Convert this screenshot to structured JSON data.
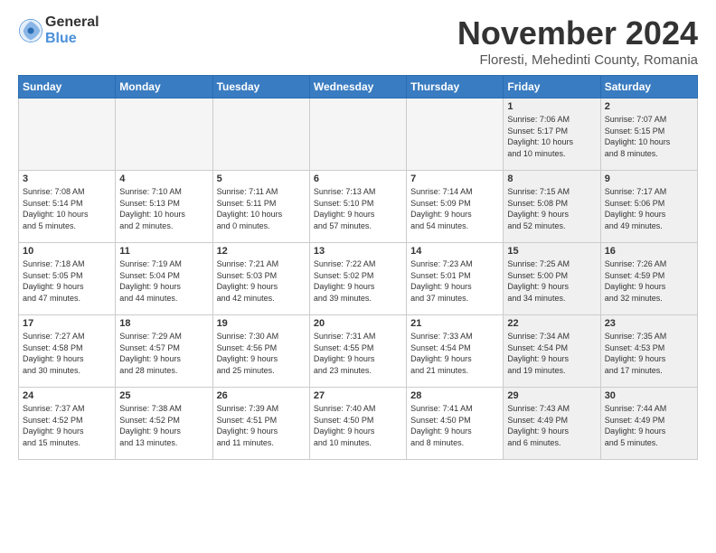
{
  "header": {
    "logo_line1": "General",
    "logo_line2": "Blue",
    "month": "November 2024",
    "location": "Floresti, Mehedinti County, Romania"
  },
  "weekdays": [
    "Sunday",
    "Monday",
    "Tuesday",
    "Wednesday",
    "Thursday",
    "Friday",
    "Saturday"
  ],
  "weeks": [
    [
      {
        "day": "",
        "info": "",
        "empty": true
      },
      {
        "day": "",
        "info": "",
        "empty": true
      },
      {
        "day": "",
        "info": "",
        "empty": true
      },
      {
        "day": "",
        "info": "",
        "empty": true
      },
      {
        "day": "",
        "info": "",
        "empty": true
      },
      {
        "day": "1",
        "info": "Sunrise: 7:06 AM\nSunset: 5:17 PM\nDaylight: 10 hours\nand 10 minutes.",
        "shaded": true
      },
      {
        "day": "2",
        "info": "Sunrise: 7:07 AM\nSunset: 5:15 PM\nDaylight: 10 hours\nand 8 minutes.",
        "shaded": true
      }
    ],
    [
      {
        "day": "3",
        "info": "Sunrise: 7:08 AM\nSunset: 5:14 PM\nDaylight: 10 hours\nand 5 minutes."
      },
      {
        "day": "4",
        "info": "Sunrise: 7:10 AM\nSunset: 5:13 PM\nDaylight: 10 hours\nand 2 minutes."
      },
      {
        "day": "5",
        "info": "Sunrise: 7:11 AM\nSunset: 5:11 PM\nDaylight: 10 hours\nand 0 minutes."
      },
      {
        "day": "6",
        "info": "Sunrise: 7:13 AM\nSunset: 5:10 PM\nDaylight: 9 hours\nand 57 minutes."
      },
      {
        "day": "7",
        "info": "Sunrise: 7:14 AM\nSunset: 5:09 PM\nDaylight: 9 hours\nand 54 minutes."
      },
      {
        "day": "8",
        "info": "Sunrise: 7:15 AM\nSunset: 5:08 PM\nDaylight: 9 hours\nand 52 minutes.",
        "shaded": true
      },
      {
        "day": "9",
        "info": "Sunrise: 7:17 AM\nSunset: 5:06 PM\nDaylight: 9 hours\nand 49 minutes.",
        "shaded": true
      }
    ],
    [
      {
        "day": "10",
        "info": "Sunrise: 7:18 AM\nSunset: 5:05 PM\nDaylight: 9 hours\nand 47 minutes."
      },
      {
        "day": "11",
        "info": "Sunrise: 7:19 AM\nSunset: 5:04 PM\nDaylight: 9 hours\nand 44 minutes."
      },
      {
        "day": "12",
        "info": "Sunrise: 7:21 AM\nSunset: 5:03 PM\nDaylight: 9 hours\nand 42 minutes."
      },
      {
        "day": "13",
        "info": "Sunrise: 7:22 AM\nSunset: 5:02 PM\nDaylight: 9 hours\nand 39 minutes."
      },
      {
        "day": "14",
        "info": "Sunrise: 7:23 AM\nSunset: 5:01 PM\nDaylight: 9 hours\nand 37 minutes."
      },
      {
        "day": "15",
        "info": "Sunrise: 7:25 AM\nSunset: 5:00 PM\nDaylight: 9 hours\nand 34 minutes.",
        "shaded": true
      },
      {
        "day": "16",
        "info": "Sunrise: 7:26 AM\nSunset: 4:59 PM\nDaylight: 9 hours\nand 32 minutes.",
        "shaded": true
      }
    ],
    [
      {
        "day": "17",
        "info": "Sunrise: 7:27 AM\nSunset: 4:58 PM\nDaylight: 9 hours\nand 30 minutes."
      },
      {
        "day": "18",
        "info": "Sunrise: 7:29 AM\nSunset: 4:57 PM\nDaylight: 9 hours\nand 28 minutes."
      },
      {
        "day": "19",
        "info": "Sunrise: 7:30 AM\nSunset: 4:56 PM\nDaylight: 9 hours\nand 25 minutes."
      },
      {
        "day": "20",
        "info": "Sunrise: 7:31 AM\nSunset: 4:55 PM\nDaylight: 9 hours\nand 23 minutes."
      },
      {
        "day": "21",
        "info": "Sunrise: 7:33 AM\nSunset: 4:54 PM\nDaylight: 9 hours\nand 21 minutes."
      },
      {
        "day": "22",
        "info": "Sunrise: 7:34 AM\nSunset: 4:54 PM\nDaylight: 9 hours\nand 19 minutes.",
        "shaded": true
      },
      {
        "day": "23",
        "info": "Sunrise: 7:35 AM\nSunset: 4:53 PM\nDaylight: 9 hours\nand 17 minutes.",
        "shaded": true
      }
    ],
    [
      {
        "day": "24",
        "info": "Sunrise: 7:37 AM\nSunset: 4:52 PM\nDaylight: 9 hours\nand 15 minutes."
      },
      {
        "day": "25",
        "info": "Sunrise: 7:38 AM\nSunset: 4:52 PM\nDaylight: 9 hours\nand 13 minutes."
      },
      {
        "day": "26",
        "info": "Sunrise: 7:39 AM\nSunset: 4:51 PM\nDaylight: 9 hours\nand 11 minutes."
      },
      {
        "day": "27",
        "info": "Sunrise: 7:40 AM\nSunset: 4:50 PM\nDaylight: 9 hours\nand 10 minutes."
      },
      {
        "day": "28",
        "info": "Sunrise: 7:41 AM\nSunset: 4:50 PM\nDaylight: 9 hours\nand 8 minutes."
      },
      {
        "day": "29",
        "info": "Sunrise: 7:43 AM\nSunset: 4:49 PM\nDaylight: 9 hours\nand 6 minutes.",
        "shaded": true
      },
      {
        "day": "30",
        "info": "Sunrise: 7:44 AM\nSunset: 4:49 PM\nDaylight: 9 hours\nand 5 minutes.",
        "shaded": true
      }
    ]
  ]
}
